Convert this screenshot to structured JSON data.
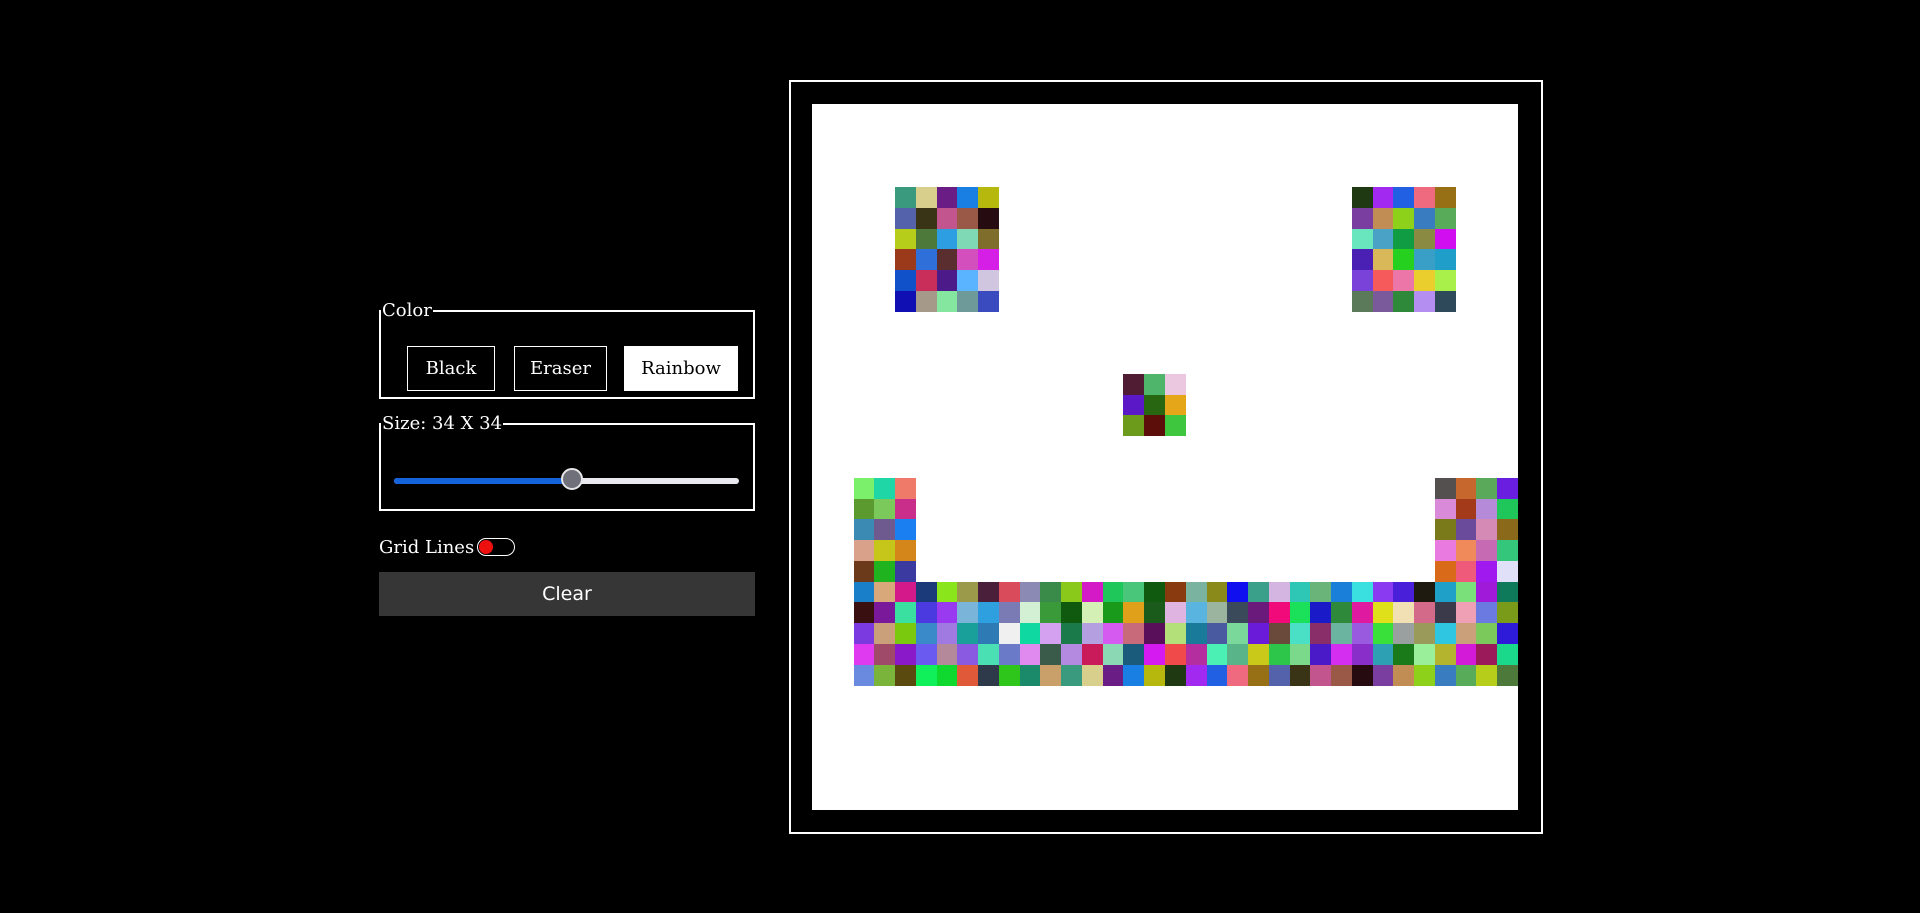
{
  "controls": {
    "color_legend": "Color",
    "buttons": [
      {
        "label": "Black",
        "active": false
      },
      {
        "label": "Eraser",
        "active": false
      },
      {
        "label": "Rainbow",
        "active": true
      }
    ],
    "size_legend": "Size: 34 X 34",
    "size_value": 34,
    "size_min": 2,
    "size_max": 64,
    "grid_lines_label": "Grid Lines",
    "grid_lines_on": false,
    "clear_label": "Clear"
  },
  "board": {
    "grid_size": 34,
    "pattern": [
      "..................................",
      "..................................",
      "..................................",
      "..................................",
      "....AAAAA.................AAAAA...",
      "....AAAAA.................AAAAA...",
      "....AAAAA.................AAAAA...",
      "....AAAAA.................AAAAA...",
      "....AAAAA.................AAAAA...",
      "....AAAAA.................AAAAA...",
      "..................................",
      "..................................",
      "..................................",
      "...............AAA................",
      "...............AAA................",
      "...............AAA................",
      "..................................",
      "..................................",
      "..AAA.........................AAAA",
      "..AAA.........................AAAA",
      "..AAA.........................AAAA",
      "..AAA.........................AAAA",
      "..AAA.........................AAAA",
      "..AAAAAAAAAAAAAAAAAAAAAAAAAAAAAAAA",
      "..AAAAAAAAAAAAAAAAAAAAAAAAAAAAAAAA",
      "..AAAAAAAAAAAAAAAAAAAAAAAAAAAAAAAA",
      "..AAAAAAAAAAAAAAAAAAAAAAAAAAAAAAAA",
      "..AAAAAAAAAAAAAAAAAAAAAAAAAAAAAAAA",
      "..................................",
      "..................................",
      "..................................",
      "..................................",
      "..................................",
      ".................................."
    ],
    "palette": [
      "#3a9a7e",
      "#d9cf8c",
      "#6b1d86",
      "#1a7fe3",
      "#b7b80d",
      "#1f3a12",
      "#a22af0",
      "#2160e3",
      "#ef6a7e",
      "#977016",
      "#5462ab",
      "#3a3417",
      "#c2558d",
      "#9a5846",
      "#260b10",
      "#7a3da0",
      "#c18d55",
      "#8ed11a",
      "#3a7cc0",
      "#58ab58",
      "#b6cd1a",
      "#4d7a3a",
      "#2e9ee3",
      "#7fd9b5",
      "#7f6d2b",
      "#6ae6be",
      "#4aa3c6",
      "#109c43",
      "#8a8a42",
      "#d10ef0",
      "#9a3a1a",
      "#2f6fd9",
      "#5a2e2e",
      "#d24fbd",
      "#d61fe6",
      "#4a1fb4",
      "#d9b85a",
      "#25d11e",
      "#3a9fc6",
      "#1f9ec9",
      "#1050c9",
      "#c92e5a",
      "#4d1a8a",
      "#5ab4ff",
      "#d0c6df",
      "#7b42d9",
      "#f75a5a",
      "#ed76a8",
      "#e9ce2e",
      "#a9f04a",
      "#0f0fb4",
      "#a59a8a",
      "#85e6a0",
      "#6e9a9a",
      "#3a4abf",
      "#5a7a5a",
      "#7a5a9a",
      "#2e8a3a",
      "#b48ef0",
      "#2e4a5a",
      "#4f1c33",
      "#4fb56b",
      "#ecc8e0",
      "#5b18c7",
      "#286612",
      "#e6a61a",
      "#6c9a1a",
      "#5c0f0a",
      "#3ec73e",
      "#7af06b",
      "#1fd6a6",
      "#f07a6a",
      "#555050",
      "#c6682e",
      "#5aa85a",
      "#6a1fe0",
      "#5a9a2e",
      "#7ac95a",
      "#c92e8a",
      "#d98ad9",
      "#a33a1a",
      "#b48ad9",
      "#1fc659",
      "#3a8ab4",
      "#6e5a8e",
      "#1a7ff0",
      "#7a7a1a",
      "#6a4a9a",
      "#d48ab4",
      "#8a6a1a",
      "#d9a08a",
      "#c6c61a",
      "#d4861a",
      "#e87ae0",
      "#f08a5a",
      "#c66ab4",
      "#34c67a",
      "#6a3a1a",
      "#1fb41f",
      "#3a3aa0",
      "#d96a1a",
      "#f05a7a",
      "#a01af0",
      "#e0e0f8"
    ],
    "extra_palette": [
      "#1a7fc9",
      "#d9a87a",
      "#d41a8a",
      "#1a3a7a",
      "#8ae61a",
      "#9a9a4a",
      "#4a1f3a",
      "#d94a5a",
      "#8a8ab4",
      "#3a8a4a",
      "#8ac91a",
      "#d41ac6",
      "#1fc65a",
      "#4ac67a",
      "#0f5a0f",
      "#8a3a0f",
      "#7ab4a0",
      "#8a8a1a",
      "#0f0ff0",
      "#3aa08a",
      "#d4b4e0",
      "#2ec6b4",
      "#6ab47a",
      "#1a7fd9",
      "#3ae0e0",
      "#8a3af0",
      "#4a1fd9",
      "#1f1a0f",
      "#1fa0c9",
      "#7ae07a",
      "#a01ad9",
      "#0f7a5a",
      "#3a0f0f",
      "#7a1a9a",
      "#3ae0a0",
      "#4a3ae0",
      "#9a3af0",
      "#7ab4d9",
      "#2ea0e0",
      "#7a7ab4",
      "#d4f0d4",
      "#3a9a3a",
      "#0f5a0f",
      "#d4f0b4",
      "#1a9a1a",
      "#e0a01a",
      "#1a5a1a",
      "#e0b4e0",
      "#5ab4e0",
      "#9ab4a0",
      "#3a4a5a",
      "#6a1a7a",
      "#f00a7a",
      "#1ae05a",
      "#1a1ac9",
      "#2e8a3a",
      "#e01aa0",
      "#e0e01a",
      "#f0e0b4",
      "#d46a8a",
      "#3a3a4a",
      "#f0a0b4",
      "#6a7ae0",
      "#7a9a1a",
      "#7a3ae0",
      "#c9a07a",
      "#7ac90f",
      "#3a8ac9",
      "#a07ae0",
      "#1aa09a",
      "#2e7ab4",
      "#f0f0f0",
      "#0fd9a0",
      "#d4a0f0",
      "#1a7a4a",
      "#b4a0e0",
      "#d45af0",
      "#c96a7a",
      "#5a0f5a",
      "#b4e07a",
      "#1a7a9a",
      "#4a5aa0",
      "#7ad99a",
      "#6a1ad9",
      "#6a4a3a",
      "#4ae0c6",
      "#8a2e6a",
      "#6ab4a0",
      "#9a5ae0",
      "#3ae03a",
      "#9aa0a0",
      "#9a9a5a",
      "#2ec6e0",
      "#c9a07a",
      "#7ac95a",
      "#2e1ad9",
      "#e03af0",
      "#a04a6a",
      "#8a1ac9",
      "#6a5af0",
      "#b48a9a",
      "#8a5ae0",
      "#4ae0b4",
      "#6a7ac9",
      "#e08af0",
      "#3a5a4a",
      "#b48ae0",
      "#c91a5a",
      "#8ad9b4",
      "#1a5a7a",
      "#d41af0",
      "#f04a4a",
      "#b42ea0",
      "#4af0b4",
      "#5ab48a",
      "#c9c91a",
      "#2ec64a",
      "#7ad98a",
      "#4a1ac9",
      "#d42ef0",
      "#8a2ec9",
      "#2ea0b4",
      "#1a7a1a",
      "#9af09a",
      "#b4b42e",
      "#d41ad9",
      "#9a1a5a",
      "#1ad98a",
      "#6a8ae0",
      "#7ab43a",
      "#5a4a0f",
      "#0ff05a",
      "#0fd92e",
      "#e05a3a",
      "#2e3a4a",
      "#2ec61a",
      "#1a8a6a",
      "#c9a06a"
    ]
  }
}
